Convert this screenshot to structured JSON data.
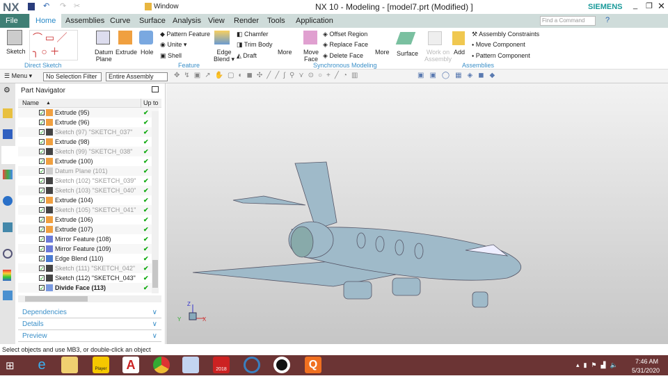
{
  "title": {
    "logo": "NX",
    "window_menu": "Window",
    "text": "NX 10 - Modeling - [model7.prt (Modified) ]",
    "brand": "SIEMENS"
  },
  "tabs": [
    "File",
    "Home",
    "Assemblies",
    "Curve",
    "Surface",
    "Analysis",
    "View",
    "Render",
    "Tools",
    "Application"
  ],
  "search_placeholder": "Find a Command",
  "ribbon": {
    "sketch": "Sketch",
    "direct_sketch": "Direct Sketch",
    "datum1": "Datum",
    "datum2": "Plane",
    "extrude": "Extrude",
    "hole": "Hole",
    "pattern_feature": "Pattern Feature",
    "unite": "Unite",
    "shell": "Shell",
    "edge1": "Edge",
    "edge2": "Blend",
    "chamfer": "Chamfer",
    "trim_body": "Trim Body",
    "draft": "Draft",
    "more": "More",
    "feature": "Feature",
    "move1": "Move",
    "move2": "Face",
    "offset_region": "Offset Region",
    "replace_face": "Replace Face",
    "delete_face": "Delete Face",
    "sync": "Synchronous Modeling",
    "surface": "Surface",
    "work1": "Work on",
    "work2": "Assembly",
    "add": "Add",
    "assembly_constraints": "Assembly Constraints",
    "move_component": "Move Component",
    "pattern_component": "Pattern Component",
    "assemblies": "Assemblies"
  },
  "toolbar": {
    "menu": "Menu",
    "filter": "No Selection Filter",
    "scope": "Entire Assembly"
  },
  "navigator": {
    "title": "Part Navigator",
    "col_name": "Name",
    "col_uptodate": "Up to D",
    "rows": [
      {
        "label": "Extrude (95)",
        "type": "extrude",
        "dim": false
      },
      {
        "label": "Extrude (96)",
        "type": "extrude",
        "dim": false
      },
      {
        "label": "Sketch (97) \"SKETCH_037\"",
        "type": "sketch",
        "dim": true
      },
      {
        "label": "Extrude (98)",
        "type": "extrude",
        "dim": false
      },
      {
        "label": "Sketch (99) \"SKETCH_038\"",
        "type": "sketch",
        "dim": true
      },
      {
        "label": "Extrude (100)",
        "type": "extrude",
        "dim": false
      },
      {
        "label": "Datum Plane (101)",
        "type": "datum",
        "dim": true
      },
      {
        "label": "Sketch (102) \"SKETCH_039\"",
        "type": "sketch",
        "dim": true
      },
      {
        "label": "Sketch (103) \"SKETCH_040\"",
        "type": "sketch",
        "dim": true
      },
      {
        "label": "Extrude (104)",
        "type": "extrude",
        "dim": false
      },
      {
        "label": "Sketch (105) \"SKETCH_041\"",
        "type": "sketch",
        "dim": true
      },
      {
        "label": "Extrude (106)",
        "type": "extrude",
        "dim": false
      },
      {
        "label": "Extrude (107)",
        "type": "extrude",
        "dim": false
      },
      {
        "label": "Mirror Feature (108)",
        "type": "mirror",
        "dim": false
      },
      {
        "label": "Mirror Feature (109)",
        "type": "mirror",
        "dim": false
      },
      {
        "label": "Edge Blend (110)",
        "type": "blend",
        "dim": false
      },
      {
        "label": "Sketch (111) \"SKETCH_042\"",
        "type": "sketch",
        "dim": true
      },
      {
        "label": "Sketch (112) \"SKETCH_043\"",
        "type": "sketch",
        "dim": false
      },
      {
        "label": "Divide Face (113)",
        "type": "divide",
        "dim": false,
        "bold": true
      }
    ],
    "panels": [
      "Dependencies",
      "Details",
      "Preview"
    ]
  },
  "status": "Select objects and use MB3, or double-click an object",
  "taskbar": {
    "time": "7:46 AM",
    "date": "5/31/2020",
    "sw": "2018",
    "player": "Player"
  }
}
